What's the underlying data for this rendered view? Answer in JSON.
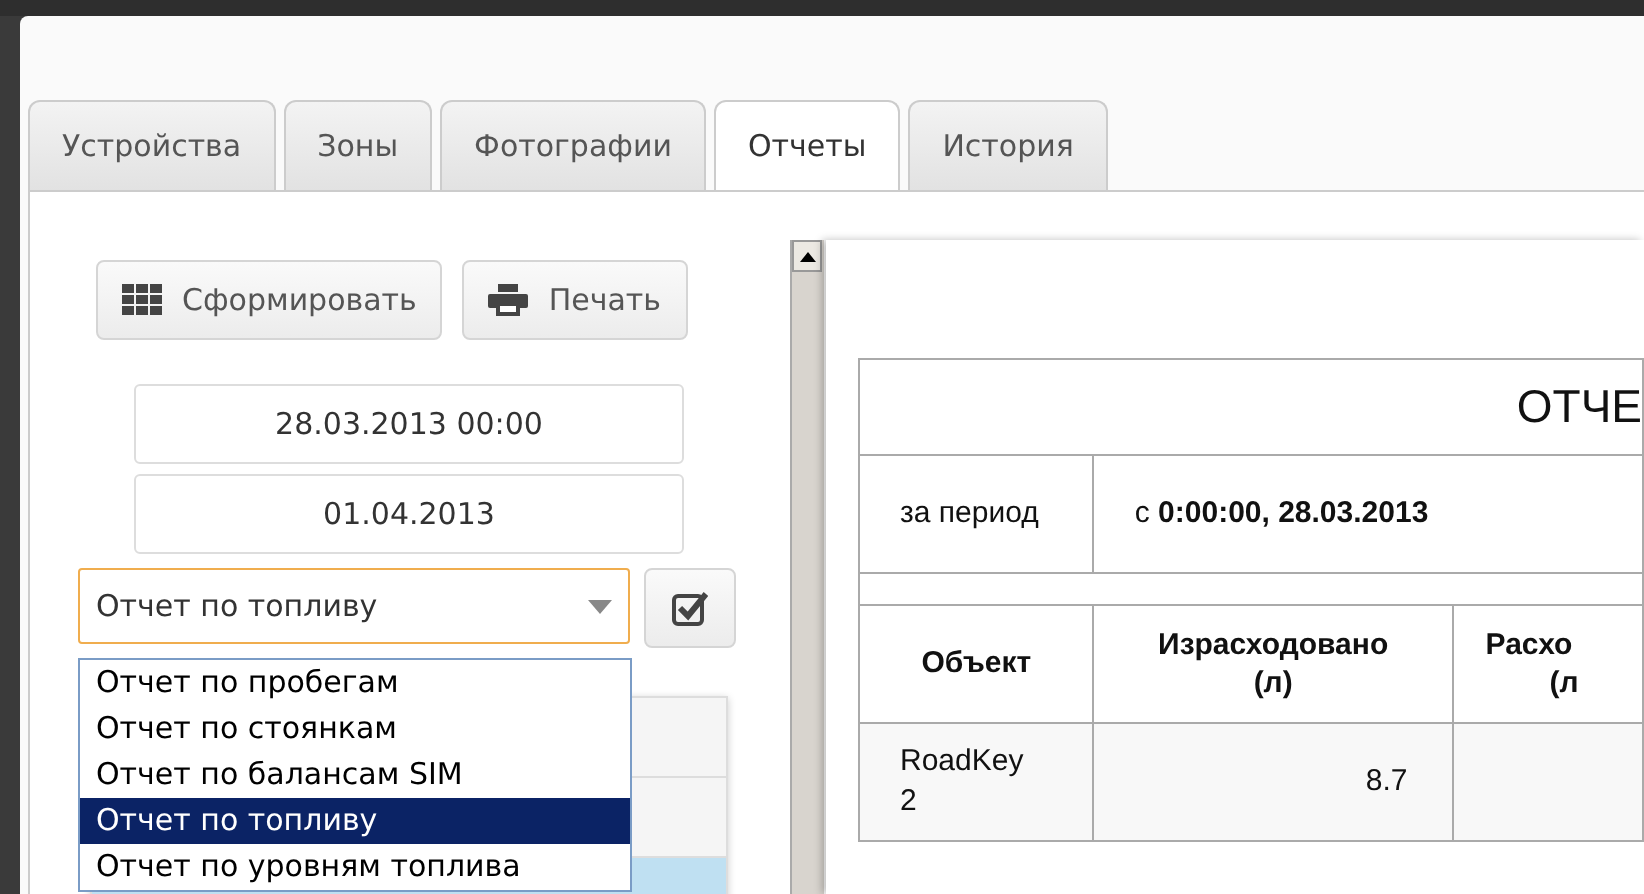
{
  "tabs": [
    {
      "label": "Устройства",
      "selected": false
    },
    {
      "label": "Зоны",
      "selected": false
    },
    {
      "label": "Фотографии",
      "selected": false
    },
    {
      "label": "Отчеты",
      "selected": true
    },
    {
      "label": "История",
      "selected": false
    }
  ],
  "actions": [
    {
      "label": "Сформировать"
    },
    {
      "label": "Печать"
    }
  ],
  "date_from": {
    "value": "28.03.2013 00:00"
  },
  "date_to": {
    "value": "01.04.2013"
  },
  "report_select": {
    "value": "Отчет по топливу",
    "expanded": true,
    "options": [
      {
        "label": "Отчет по пробегам",
        "selected": false
      },
      {
        "label": "Отчет по стоянкам",
        "selected": false
      },
      {
        "label": "Отчет по балансам SIM",
        "selected": false
      },
      {
        "label": "Отчет по топливу",
        "selected": true
      },
      {
        "label": "Отчет по уровням топлива",
        "selected": false
      }
    ]
  },
  "report": {
    "title": "ОТЧЕ",
    "period_label": "за период",
    "period_value": "с **0:00:00, 28.03.2013**",
    "columns": [
      {
        "lines": [
          "Объект"
        ]
      },
      {
        "lines": [
          "Израсходовано",
          "(л)"
        ]
      },
      {
        "lines": [
          "Расхо",
          "(л"
        ]
      }
    ],
    "rows": [
      {
        "object": "RoadKey 2",
        "spent": "8.7"
      }
    ]
  }
}
